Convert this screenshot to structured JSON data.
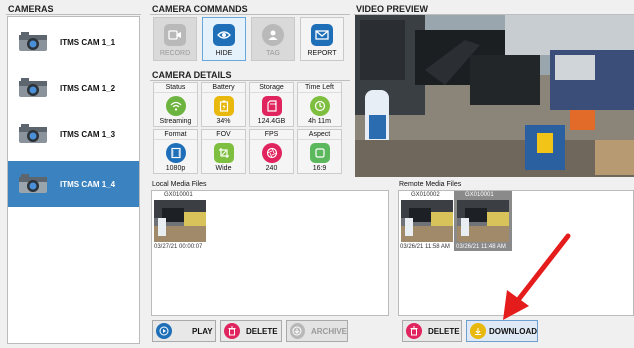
{
  "sections": {
    "cameras": "CAMERAS",
    "commands": "CAMERA COMMANDS",
    "details": "CAMERA DETAILS",
    "preview": "VIDEO PREVIEW",
    "local_media": "Local Media Files",
    "remote_media": "Remote Media Files"
  },
  "cameras": [
    {
      "label": "ITMS CAM 1_1",
      "selected": false
    },
    {
      "label": "ITMS CAM 1_2",
      "selected": false
    },
    {
      "label": "ITMS CAM 1_3",
      "selected": false
    },
    {
      "label": "ITMS CAM 1_4",
      "selected": true
    }
  ],
  "commands": [
    {
      "label": "RECORD",
      "icon": "video-camera-icon",
      "enabled": false
    },
    {
      "label": "HIDE",
      "icon": "eye-icon",
      "enabled": true
    },
    {
      "label": "TAG",
      "icon": "person-tag-icon",
      "enabled": false
    },
    {
      "label": "REPORT",
      "icon": "mail-icon",
      "enabled": true
    }
  ],
  "details": [
    {
      "title": "Status",
      "value": "Streaming",
      "icon": "wifi-icon",
      "color": "#6db33f"
    },
    {
      "title": "Battery",
      "value": "34%",
      "icon": "battery-icon",
      "color": "#e8b90c"
    },
    {
      "title": "Storage",
      "value": "124.4GB",
      "icon": "sd-card-icon",
      "color": "#e0245e"
    },
    {
      "title": "Time Left",
      "value": "4h 11m",
      "icon": "clock-icon",
      "color": "#7fbf3f"
    },
    {
      "title": "Format",
      "value": "1080p",
      "icon": "film-icon",
      "color": "#1e6fb8"
    },
    {
      "title": "FOV",
      "value": "Wide",
      "icon": "crop-icon",
      "color": "#7fbf3f"
    },
    {
      "title": "FPS",
      "value": "240",
      "icon": "aperture-icon",
      "color": "#e0245e"
    },
    {
      "title": "Aspect",
      "value": "16:9",
      "icon": "aspect-icon",
      "color": "#5cb85c"
    }
  ],
  "local_files": [
    {
      "name": "GX010001",
      "date": "03/27/21 00:00:07"
    }
  ],
  "remote_files": [
    {
      "name": "GX010002",
      "date": "03/26/21 11:58 AM",
      "selected": false
    },
    {
      "name": "GX010001",
      "date": "03/26/21 11:48 AM",
      "selected": true
    }
  ],
  "local_buttons": {
    "play": "PLAY",
    "delete": "DELETE",
    "archive": "ARCHIVE"
  },
  "remote_buttons": {
    "delete": "DELETE",
    "download": "DOWNLOAD"
  },
  "colors": {
    "selected": "#3b83c0",
    "annotation_arrow": "#e51c1c",
    "play": "#1e6fb8",
    "delete": "#e0245e",
    "download": "#e8b90c"
  }
}
